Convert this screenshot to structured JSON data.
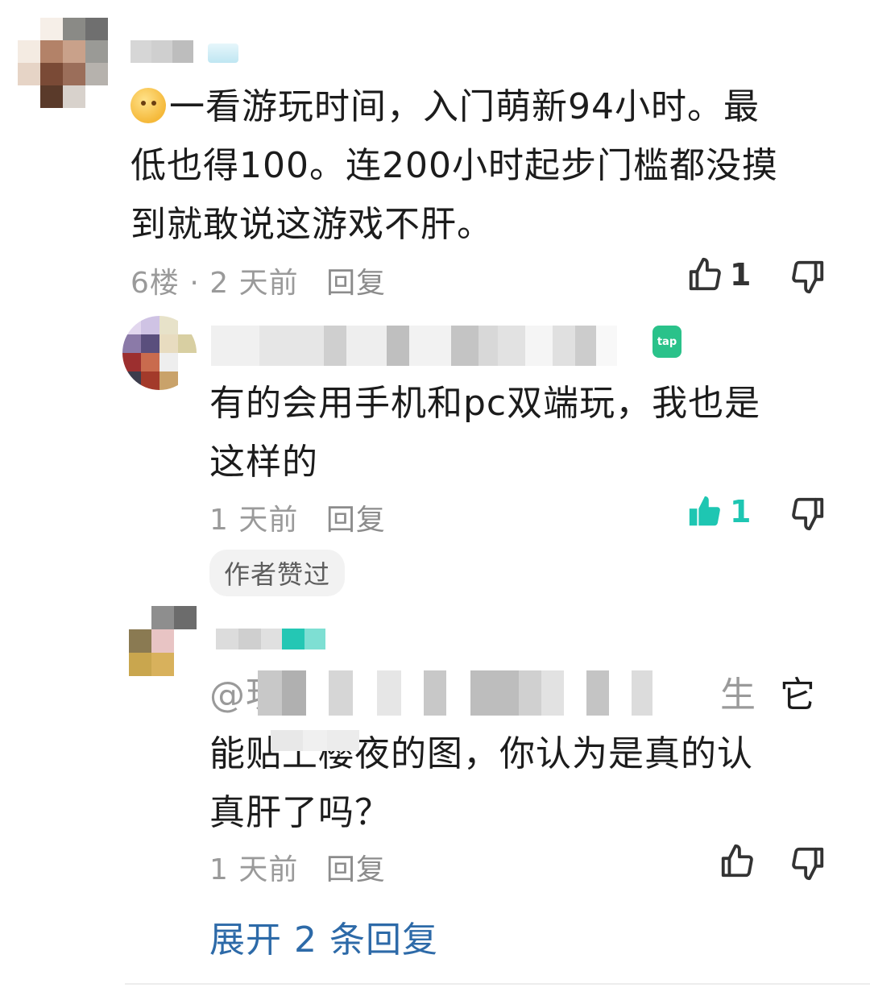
{
  "comments": [
    {
      "emoji": "smiling-face",
      "text_line1": "一看游玩时间，入门萌新94小时。最",
      "text_line2": "低也得100。连200小时起步门槛都没摸",
      "text_line3": "到就敢说这游戏不肝。",
      "floor": "6楼",
      "sep": "·",
      "time": "2 天前",
      "reply": "回复",
      "likes": "1"
    },
    {
      "name_hint": "玩影之读都",
      "app_badge": "tap",
      "text_line1": "有的会用手机和pc双端玩，我也是",
      "text_line2": "这样的",
      "time": "1 天前",
      "reply": "回复",
      "likes": "1",
      "author_liked": "作者赞过"
    },
    {
      "mention_prefix": "@玥",
      "mention_suffix": "生",
      "text_line1_tail": "它",
      "text_line2": "能贴上樱夜的图，你认为是真的认",
      "text_line3": "真肝了吗？",
      "time": "1 天前",
      "reply": "回复"
    }
  ],
  "expand_replies": "展开 2 条回复",
  "colors": {
    "accent_teal": "#1ec6b2",
    "link_blue": "#2d6aa8",
    "meta_gray": "#9a9a9a"
  }
}
